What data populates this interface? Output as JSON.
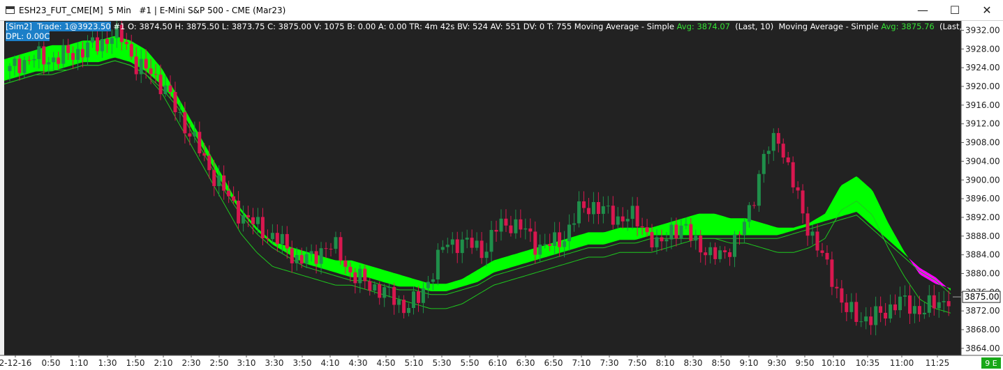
{
  "window": {
    "title": "ESH23_FUT_CME[M]  5 Min   #1 | E-Mini S&P 500 - CME (Mar23)",
    "buttons": [
      "—",
      "☐",
      "✕"
    ]
  },
  "header": {
    "account": "[Sim2]  Trade: 1@3923.50",
    "ohlc": " #1 O: 3874.50 H: 3875.50 L: 3873.75 C: 3875.00 V: 1075 B: 0.00 A: 0.00 TR: 4m 42s BV: 524 AV: 551 DV: 0 T: 755 Moving Average - Simple ",
    "avg1": "Avg: 3874.07",
    "ma1_params": "  (Last, 10)  Moving Average - Simple ",
    "avg2": "Avg: 3875.76",
    "ma2_params": "  (Last,",
    "dpl": "DPL: 0.00C"
  },
  "colors": {
    "background": "#222222",
    "up": "#1f8f4a",
    "down": "#d8174f",
    "ribbon_up": "#00ff00",
    "ribbon_down": "#ff00ff",
    "ma_lines": "#1ec81e",
    "price_tag_bg": "#ffffff"
  },
  "chart_data": {
    "type": "candlestick",
    "instrument": "E-Mini S&P 500 - CME (Mar23)",
    "interval": "5 Min",
    "ylim": [
      3862.5,
      3934.0
    ],
    "y_ticks": [
      3932.0,
      3928.0,
      3924.0,
      3920.0,
      3916.0,
      3912.0,
      3908.0,
      3904.0,
      3900.0,
      3896.0,
      3892.0,
      3888.0,
      3884.0,
      3880.0,
      3876.0,
      3872.0,
      3868.0,
      3864.0
    ],
    "x_labels": [
      "2-12-16",
      "0:50",
      "1:10",
      "1:30",
      "1:50",
      "2:10",
      "2:30",
      "2:50",
      "3:10",
      "3:30",
      "3:50",
      "4:10",
      "4:30",
      "4:50",
      "5:10",
      "5:30",
      "5:50",
      "6:10",
      "6:30",
      "6:50",
      "7:10",
      "7:30",
      "7:50",
      "8:10",
      "8:30",
      "8:50",
      "9:10",
      "9:30",
      "9:50",
      "10:10",
      "10:35",
      "11:00",
      "11:25"
    ],
    "last_price": "3875.00",
    "corner_label": "9 E",
    "close_path": [
      3922,
      3925,
      3926,
      3926,
      3926,
      3927,
      3928,
      3929,
      3931,
      3930,
      3924,
      3923,
      3920,
      3914,
      3910,
      3904,
      3900,
      3895,
      3892,
      3890,
      3888,
      3886,
      3883,
      3883,
      3886,
      3885,
      3880,
      3878,
      3877,
      3875,
      3873,
      3874,
      3880,
      3886,
      3887,
      3886,
      3885,
      3890,
      3891,
      3889,
      3886,
      3886,
      3888,
      3893,
      3895,
      3893,
      3892,
      3892,
      3890,
      3885,
      3890,
      3889,
      3887,
      3883,
      3885,
      3887,
      3895,
      3905,
      3910,
      3900,
      3892,
      3885,
      3880,
      3872,
      3871,
      3870,
      3872,
      3874,
      3873,
      3872,
      3874,
      3875
    ],
    "ma_fast_path": [
      3924,
      3925,
      3926,
      3927,
      3927,
      3928,
      3928,
      3929,
      3928,
      3926,
      3922,
      3916,
      3910,
      3904,
      3898,
      3892,
      3888,
      3885,
      3884,
      3883,
      3882,
      3881,
      3881,
      3880,
      3879,
      3878,
      3877,
      3876,
      3876,
      3877,
      3879,
      3881,
      3882,
      3883,
      3884,
      3885,
      3886,
      3887,
      3887,
      3888,
      3888,
      3888,
      3889,
      3890,
      3891,
      3891,
      3890,
      3890,
      3889,
      3888,
      3888,
      3889,
      3891,
      3897,
      3899,
      3896,
      3889,
      3883,
      3878,
      3876,
      3875
    ],
    "ma_slow_path": [
      3923,
      3924,
      3925,
      3925,
      3926,
      3927,
      3927,
      3928,
      3927,
      3925,
      3922,
      3918,
      3912,
      3906,
      3900,
      3895,
      3891,
      3888,
      3886,
      3884,
      3883,
      3882,
      3881,
      3881,
      3880,
      3879,
      3879,
      3878,
      3878,
      3879,
      3880,
      3882,
      3883,
      3884,
      3885,
      3886,
      3887,
      3888,
      3888,
      3889,
      3889,
      3890,
      3890,
      3890,
      3890,
      3890,
      3890,
      3890,
      3890,
      3890,
      3891,
      3892,
      3893,
      3894,
      3895,
      3892,
      3889,
      3886,
      3883,
      3881,
      3878
    ]
  }
}
